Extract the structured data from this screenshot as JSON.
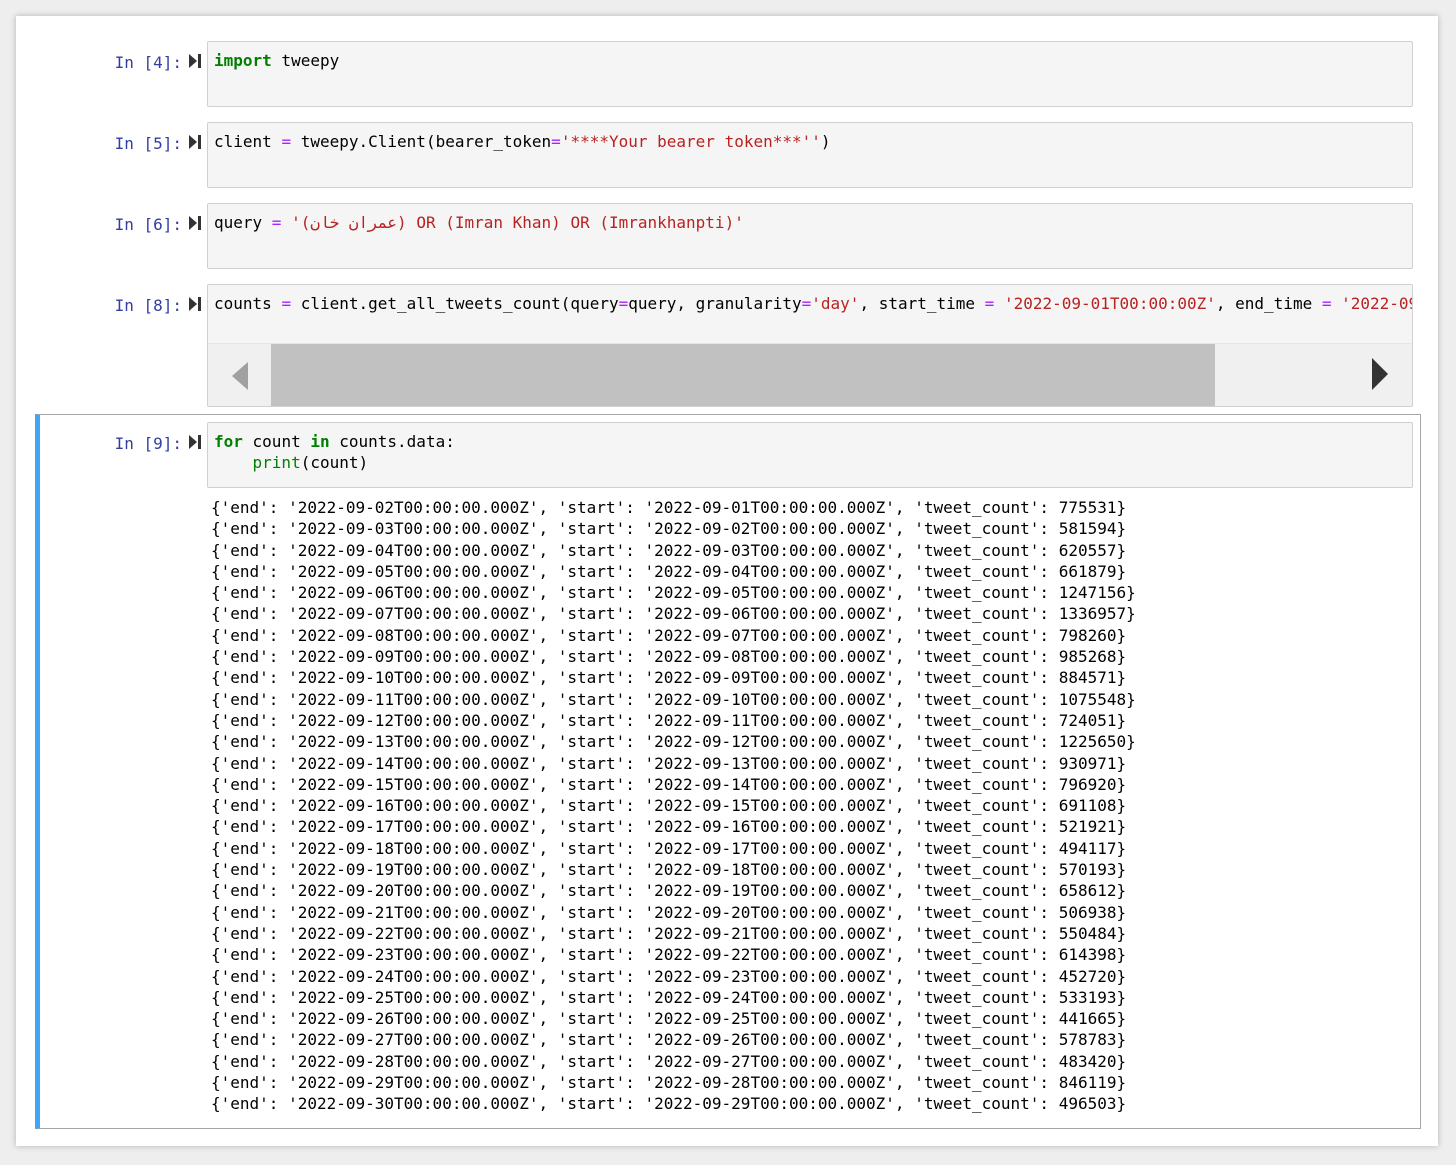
{
  "cells": [
    {
      "prompt": "In [4]:",
      "tokens": [
        {
          "t": "import",
          "c": "kw"
        },
        {
          "t": " tweepy",
          "c": ""
        }
      ]
    },
    {
      "prompt": "In [5]:",
      "tokens": [
        {
          "t": "client ",
          "c": ""
        },
        {
          "t": "=",
          "c": "op"
        },
        {
          "t": " tweepy.Client(bearer_token",
          "c": ""
        },
        {
          "t": "=",
          "c": "op"
        },
        {
          "t": "'****Your bearer token***''",
          "c": "str"
        },
        {
          "t": ")",
          "c": ""
        }
      ]
    },
    {
      "prompt": "In [6]:",
      "tokens": [
        {
          "t": "query ",
          "c": ""
        },
        {
          "t": "=",
          "c": "op"
        },
        {
          "t": " ",
          "c": ""
        },
        {
          "t": "'(عمران خان) OR (Imran Khan) OR (Imrankhanpti)'",
          "c": "str"
        }
      ]
    },
    {
      "prompt": "In [8]:",
      "tokens": [
        {
          "t": "counts ",
          "c": ""
        },
        {
          "t": "=",
          "c": "op"
        },
        {
          "t": " client.get_all_tweets_count(query",
          "c": ""
        },
        {
          "t": "=",
          "c": "op"
        },
        {
          "t": "query, granularity",
          "c": ""
        },
        {
          "t": "=",
          "c": "op"
        },
        {
          "t": "'day'",
          "c": "str"
        },
        {
          "t": ", start_time ",
          "c": ""
        },
        {
          "t": "=",
          "c": "op"
        },
        {
          "t": " ",
          "c": ""
        },
        {
          "t": "'2022-09-01T00:00:00Z'",
          "c": "str"
        },
        {
          "t": ", end_time ",
          "c": ""
        },
        {
          "t": "=",
          "c": "op"
        },
        {
          "t": " ",
          "c": ""
        },
        {
          "t": "'2022-09",
          "c": "str"
        }
      ]
    }
  ],
  "cell9": {
    "prompt": "In [9]:",
    "line1": [
      {
        "t": "for",
        "c": "kw"
      },
      {
        "t": " count ",
        "c": ""
      },
      {
        "t": "in",
        "c": "kw"
      },
      {
        "t": " counts.data:",
        "c": ""
      }
    ],
    "line2": [
      {
        "t": "    ",
        "c": ""
      },
      {
        "t": "print",
        "c": "bi"
      },
      {
        "t": "(count)",
        "c": ""
      }
    ],
    "output": [
      "{'end': '2022-09-02T00:00:00.000Z', 'start': '2022-09-01T00:00:00.000Z', 'tweet_count': 775531}",
      "{'end': '2022-09-03T00:00:00.000Z', 'start': '2022-09-02T00:00:00.000Z', 'tweet_count': 581594}",
      "{'end': '2022-09-04T00:00:00.000Z', 'start': '2022-09-03T00:00:00.000Z', 'tweet_count': 620557}",
      "{'end': '2022-09-05T00:00:00.000Z', 'start': '2022-09-04T00:00:00.000Z', 'tweet_count': 661879}",
      "{'end': '2022-09-06T00:00:00.000Z', 'start': '2022-09-05T00:00:00.000Z', 'tweet_count': 1247156}",
      "{'end': '2022-09-07T00:00:00.000Z', 'start': '2022-09-06T00:00:00.000Z', 'tweet_count': 1336957}",
      "{'end': '2022-09-08T00:00:00.000Z', 'start': '2022-09-07T00:00:00.000Z', 'tweet_count': 798260}",
      "{'end': '2022-09-09T00:00:00.000Z', 'start': '2022-09-08T00:00:00.000Z', 'tweet_count': 985268}",
      "{'end': '2022-09-10T00:00:00.000Z', 'start': '2022-09-09T00:00:00.000Z', 'tweet_count': 884571}",
      "{'end': '2022-09-11T00:00:00.000Z', 'start': '2022-09-10T00:00:00.000Z', 'tweet_count': 1075548}",
      "{'end': '2022-09-12T00:00:00.000Z', 'start': '2022-09-11T00:00:00.000Z', 'tweet_count': 724051}",
      "{'end': '2022-09-13T00:00:00.000Z', 'start': '2022-09-12T00:00:00.000Z', 'tweet_count': 1225650}",
      "{'end': '2022-09-14T00:00:00.000Z', 'start': '2022-09-13T00:00:00.000Z', 'tweet_count': 930971}",
      "{'end': '2022-09-15T00:00:00.000Z', 'start': '2022-09-14T00:00:00.000Z', 'tweet_count': 796920}",
      "{'end': '2022-09-16T00:00:00.000Z', 'start': '2022-09-15T00:00:00.000Z', 'tweet_count': 691108}",
      "{'end': '2022-09-17T00:00:00.000Z', 'start': '2022-09-16T00:00:00.000Z', 'tweet_count': 521921}",
      "{'end': '2022-09-18T00:00:00.000Z', 'start': '2022-09-17T00:00:00.000Z', 'tweet_count': 494117}",
      "{'end': '2022-09-19T00:00:00.000Z', 'start': '2022-09-18T00:00:00.000Z', 'tweet_count': 570193}",
      "{'end': '2022-09-20T00:00:00.000Z', 'start': '2022-09-19T00:00:00.000Z', 'tweet_count': 658612}",
      "{'end': '2022-09-21T00:00:00.000Z', 'start': '2022-09-20T00:00:00.000Z', 'tweet_count': 506938}",
      "{'end': '2022-09-22T00:00:00.000Z', 'start': '2022-09-21T00:00:00.000Z', 'tweet_count': 550484}",
      "{'end': '2022-09-23T00:00:00.000Z', 'start': '2022-09-22T00:00:00.000Z', 'tweet_count': 614398}",
      "{'end': '2022-09-24T00:00:00.000Z', 'start': '2022-09-23T00:00:00.000Z', 'tweet_count': 452720}",
      "{'end': '2022-09-25T00:00:00.000Z', 'start': '2022-09-24T00:00:00.000Z', 'tweet_count': 533193}",
      "{'end': '2022-09-26T00:00:00.000Z', 'start': '2022-09-25T00:00:00.000Z', 'tweet_count': 441665}",
      "{'end': '2022-09-27T00:00:00.000Z', 'start': '2022-09-26T00:00:00.000Z', 'tweet_count': 578783}",
      "{'end': '2022-09-28T00:00:00.000Z', 'start': '2022-09-27T00:00:00.000Z', 'tweet_count': 483420}",
      "{'end': '2022-09-29T00:00:00.000Z', 'start': '2022-09-28T00:00:00.000Z', 'tweet_count': 846119}",
      "{'end': '2022-09-30T00:00:00.000Z', 'start': '2022-09-29T00:00:00.000Z', 'tweet_count': 496503}"
    ]
  },
  "icons": {
    "run": "run-cell-icon",
    "scroll_left": "scroll-left-arrow-icon",
    "scroll_right": "scroll-right-arrow-icon"
  },
  "colors": {
    "prompt": "#303f9f",
    "keyword": "#008000",
    "operator": "#aa22ff",
    "string": "#ba2121",
    "selected_cell_bar": "#42a5f5"
  }
}
